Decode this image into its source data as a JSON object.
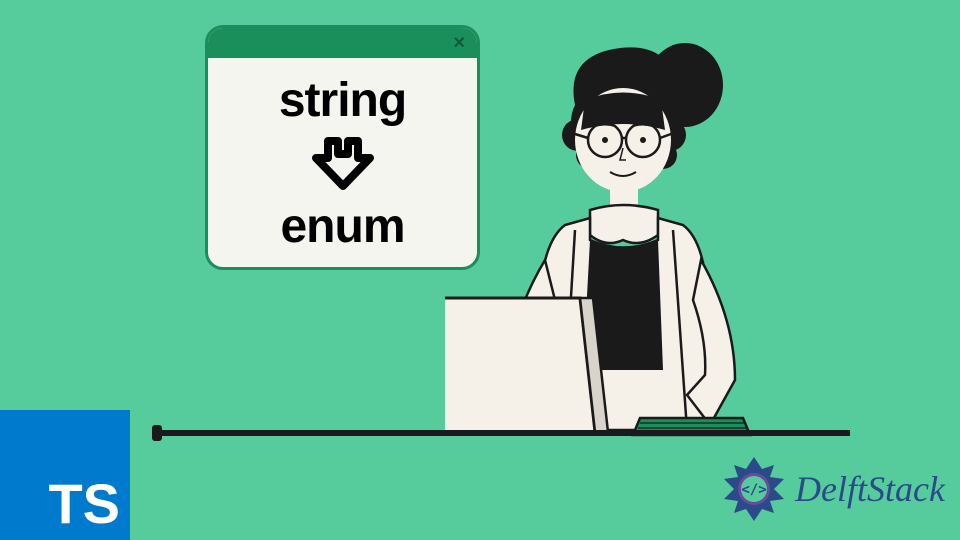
{
  "window": {
    "top_text": "string",
    "bottom_text": "enum"
  },
  "ts_logo": "TS",
  "delftstack": "DelftStack"
}
